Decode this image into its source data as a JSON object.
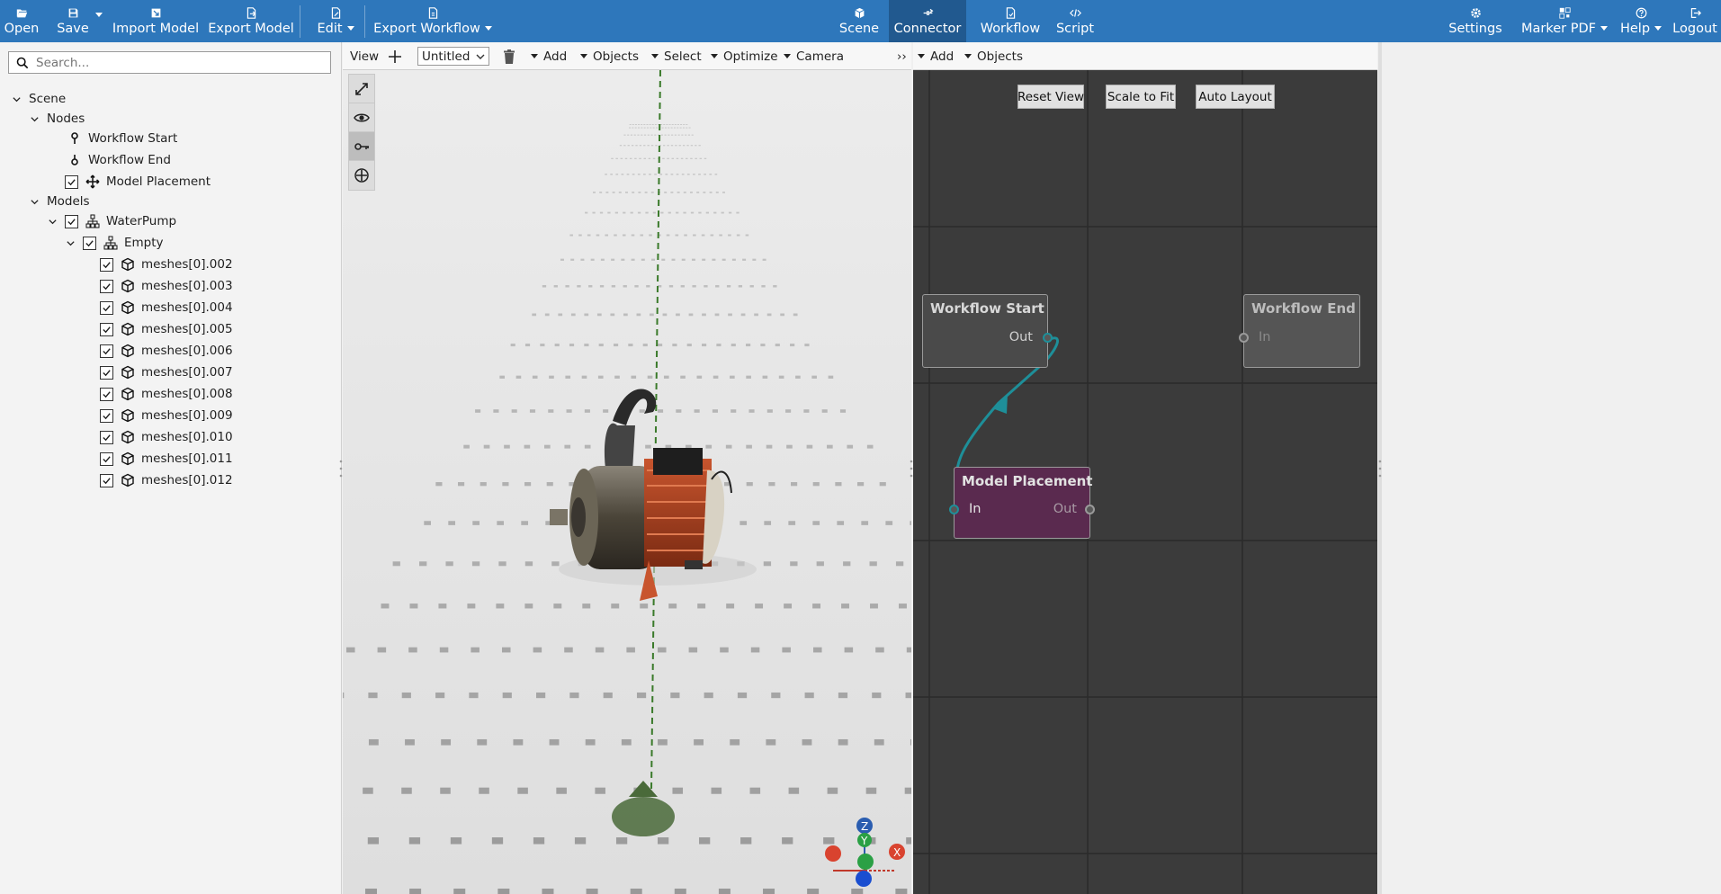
{
  "topbar": {
    "left": [
      {
        "label": "Open",
        "icon": "folder-open-icon"
      },
      {
        "label": "Save",
        "icon": "save-icon"
      },
      {
        "label": "Import Model",
        "icon": "import-icon"
      },
      {
        "label": "Export Model",
        "icon": "export-icon"
      },
      {
        "label": "Edit",
        "icon": "edit-doc-icon"
      },
      {
        "label": "Export Workflow",
        "icon": "document-icon"
      }
    ],
    "center": [
      {
        "label": "Scene",
        "icon": "cube-icon"
      },
      {
        "label": "Connector",
        "icon": "connector-icon"
      },
      {
        "label": "Workflow",
        "icon": "workflow-doc-icon"
      },
      {
        "label": "Script",
        "icon": "code-icon"
      }
    ],
    "right": [
      {
        "label": "Settings",
        "icon": "gear-icon"
      },
      {
        "label": "Marker PDF",
        "icon": "marker-pdf-icon"
      },
      {
        "label": "Help",
        "icon": "help-icon"
      },
      {
        "label": "Logout",
        "icon": "logout-icon"
      }
    ],
    "accent_color": "#2e77bb",
    "active_color": "#21598f"
  },
  "search": {
    "placeholder": "Search..."
  },
  "tree": {
    "scene": "Scene",
    "nodes": "Nodes",
    "workflow_start": "Workflow Start",
    "workflow_end": "Workflow End",
    "model_placement": "Model Placement",
    "models": "Models",
    "water_pump": "WaterPump",
    "empty": "Empty",
    "meshes": [
      "meshes[0].002",
      "meshes[0].003",
      "meshes[0].004",
      "meshes[0].005",
      "meshes[0].006",
      "meshes[0].007",
      "meshes[0].008",
      "meshes[0].009",
      "meshes[0].010",
      "meshes[0].011",
      "meshes[0].012"
    ]
  },
  "viewport_toolbar": {
    "view": "View",
    "document": "Untitled",
    "add": "Add",
    "objects": "Objects",
    "select": "Select",
    "optimize": "Optimize",
    "camera": "Camera",
    "more": "››"
  },
  "axes": {
    "z": "Z",
    "y": "Y",
    "x": "X"
  },
  "node_toolbar": {
    "add": "Add",
    "objects": "Objects"
  },
  "node_buttons": {
    "reset": "Reset View",
    "scale": "Scale to Fit",
    "layout": "Auto Layout"
  },
  "nodes": {
    "start": {
      "title": "Workflow Start",
      "out": "Out"
    },
    "end": {
      "title": "Workflow End",
      "in": "In"
    },
    "placement": {
      "title": "Model Placement",
      "in": "In",
      "out": "Out",
      "color": "#5a2a4f"
    }
  },
  "link_color": "#1e8f99"
}
